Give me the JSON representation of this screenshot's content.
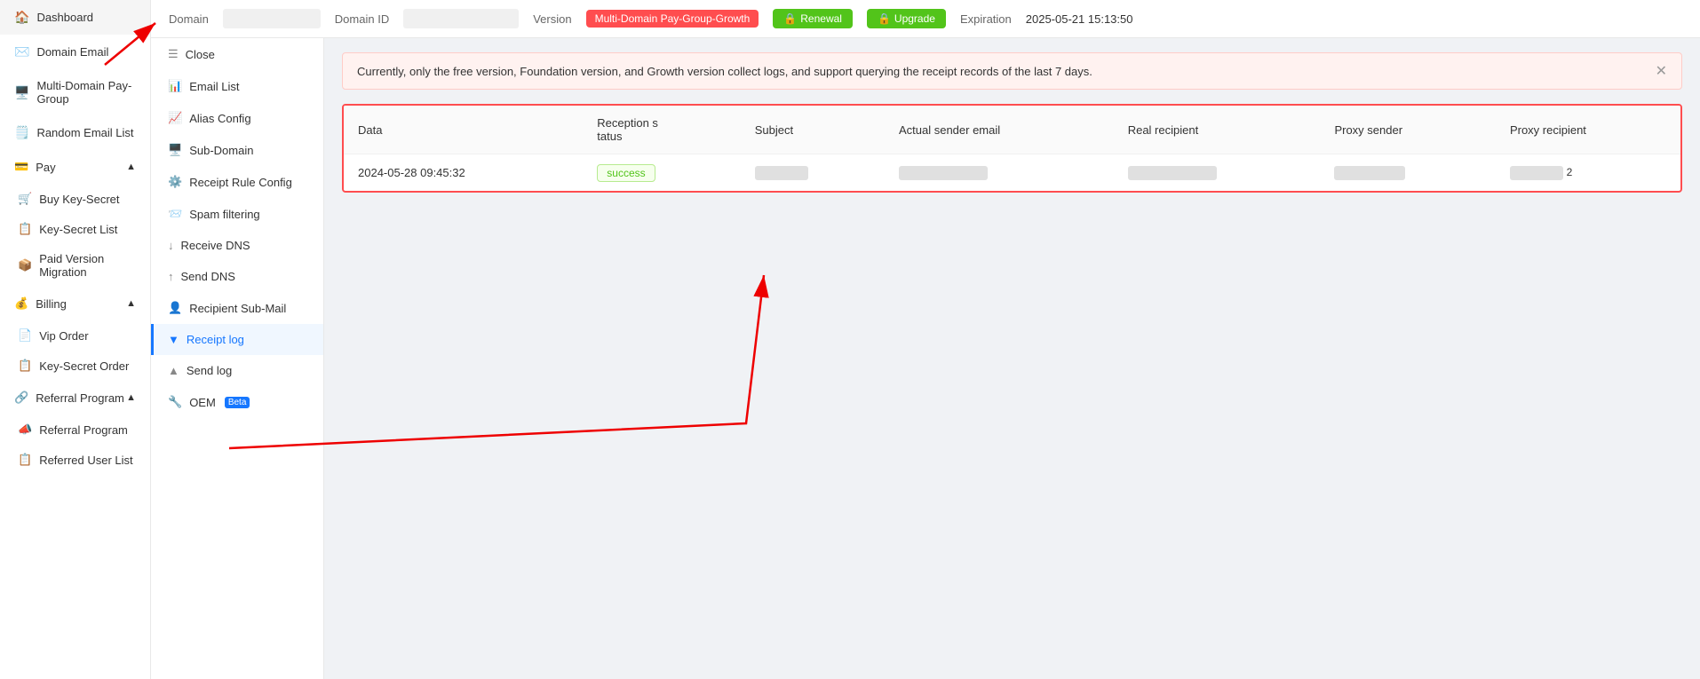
{
  "sidebar": {
    "items": [
      {
        "id": "dashboard",
        "label": "Dashboard",
        "icon": "🏠"
      },
      {
        "id": "domain-email",
        "label": "Domain Email",
        "icon": "✉️"
      },
      {
        "id": "multi-domain",
        "label": "Multi-Domain Pay-Group",
        "icon": "🖥️"
      },
      {
        "id": "random-email",
        "label": "Random Email List",
        "icon": "🗒️"
      },
      {
        "id": "pay",
        "label": "Pay",
        "icon": "💳",
        "hasChildren": true,
        "expanded": true
      },
      {
        "id": "buy-key-secret",
        "label": "Buy Key-Secret",
        "icon": "🛒",
        "indent": true
      },
      {
        "id": "key-secret-list",
        "label": "Key-Secret List",
        "icon": "📋",
        "indent": true
      },
      {
        "id": "paid-version-migration",
        "label": "Paid Version Migration",
        "icon": "📦",
        "indent": true
      },
      {
        "id": "billing",
        "label": "Billing",
        "icon": "💰",
        "hasChildren": true,
        "expanded": true
      },
      {
        "id": "vip-order",
        "label": "Vip Order",
        "icon": "📄",
        "indent": true
      },
      {
        "id": "key-secret-order",
        "label": "Key-Secret Order",
        "icon": "📋",
        "indent": true
      },
      {
        "id": "referral-program-group",
        "label": "Referral Program",
        "icon": "🔗",
        "hasChildren": true,
        "expanded": true
      },
      {
        "id": "referral-program",
        "label": "Referral Program",
        "icon": "📣",
        "indent": true
      },
      {
        "id": "referred-user-list",
        "label": "Referred User List",
        "icon": "📋",
        "indent": true
      }
    ]
  },
  "topbar": {
    "domain_label": "Domain",
    "domain_id_label": "Domain ID",
    "version_label": "Version",
    "version_value": "Multi-Domain Pay-Group-Growth",
    "renewal_label": "Renewal",
    "upgrade_label": "Upgrade",
    "expiration_label": "Expiration",
    "expiration_value": "2025-05-21 15:13:50"
  },
  "subsidebar": {
    "items": [
      {
        "id": "close",
        "label": "Close",
        "icon": "☰"
      },
      {
        "id": "email-list",
        "label": "Email List",
        "icon": "📊"
      },
      {
        "id": "alias-config",
        "label": "Alias Config",
        "icon": "📈"
      },
      {
        "id": "sub-domain",
        "label": "Sub-Domain",
        "icon": "🖥️"
      },
      {
        "id": "receipt-rule-config",
        "label": "Receipt Rule Config",
        "icon": "⚙️"
      },
      {
        "id": "spam-filtering",
        "label": "Spam filtering",
        "icon": "📨"
      },
      {
        "id": "receive-dns",
        "label": "Receive DNS",
        "icon": "↓"
      },
      {
        "id": "send-dns",
        "label": "Send DNS",
        "icon": "↑"
      },
      {
        "id": "recipient-sub-mail",
        "label": "Recipient Sub-Mail",
        "icon": "👤"
      },
      {
        "id": "receipt-log",
        "label": "Receipt log",
        "icon": "▼",
        "active": true
      },
      {
        "id": "send-log",
        "label": "Send log",
        "icon": "▲"
      },
      {
        "id": "oem",
        "label": "OEM",
        "icon": "🔧",
        "beta": true
      }
    ]
  },
  "alert": {
    "message": "Currently, only the free version, Foundation version, and Growth version collect logs, and support querying the receipt records of the last 7 days."
  },
  "table": {
    "columns": [
      {
        "id": "data",
        "label": "Data"
      },
      {
        "id": "reception-status",
        "label": "Reception s\ntatus"
      },
      {
        "id": "subject",
        "label": "Subject"
      },
      {
        "id": "actual-sender",
        "label": "Actual sender email"
      },
      {
        "id": "real-recipient",
        "label": "Real recipient"
      },
      {
        "id": "proxy-sender",
        "label": "Proxy sender"
      },
      {
        "id": "proxy-recipient",
        "label": "Proxy recipient"
      }
    ],
    "rows": [
      {
        "data": "2024-05-28 09:45:32",
        "status": "success",
        "subject": "",
        "actual_sender": "",
        "real_recipient": "",
        "proxy_sender": "",
        "proxy_recipient": ""
      }
    ]
  }
}
